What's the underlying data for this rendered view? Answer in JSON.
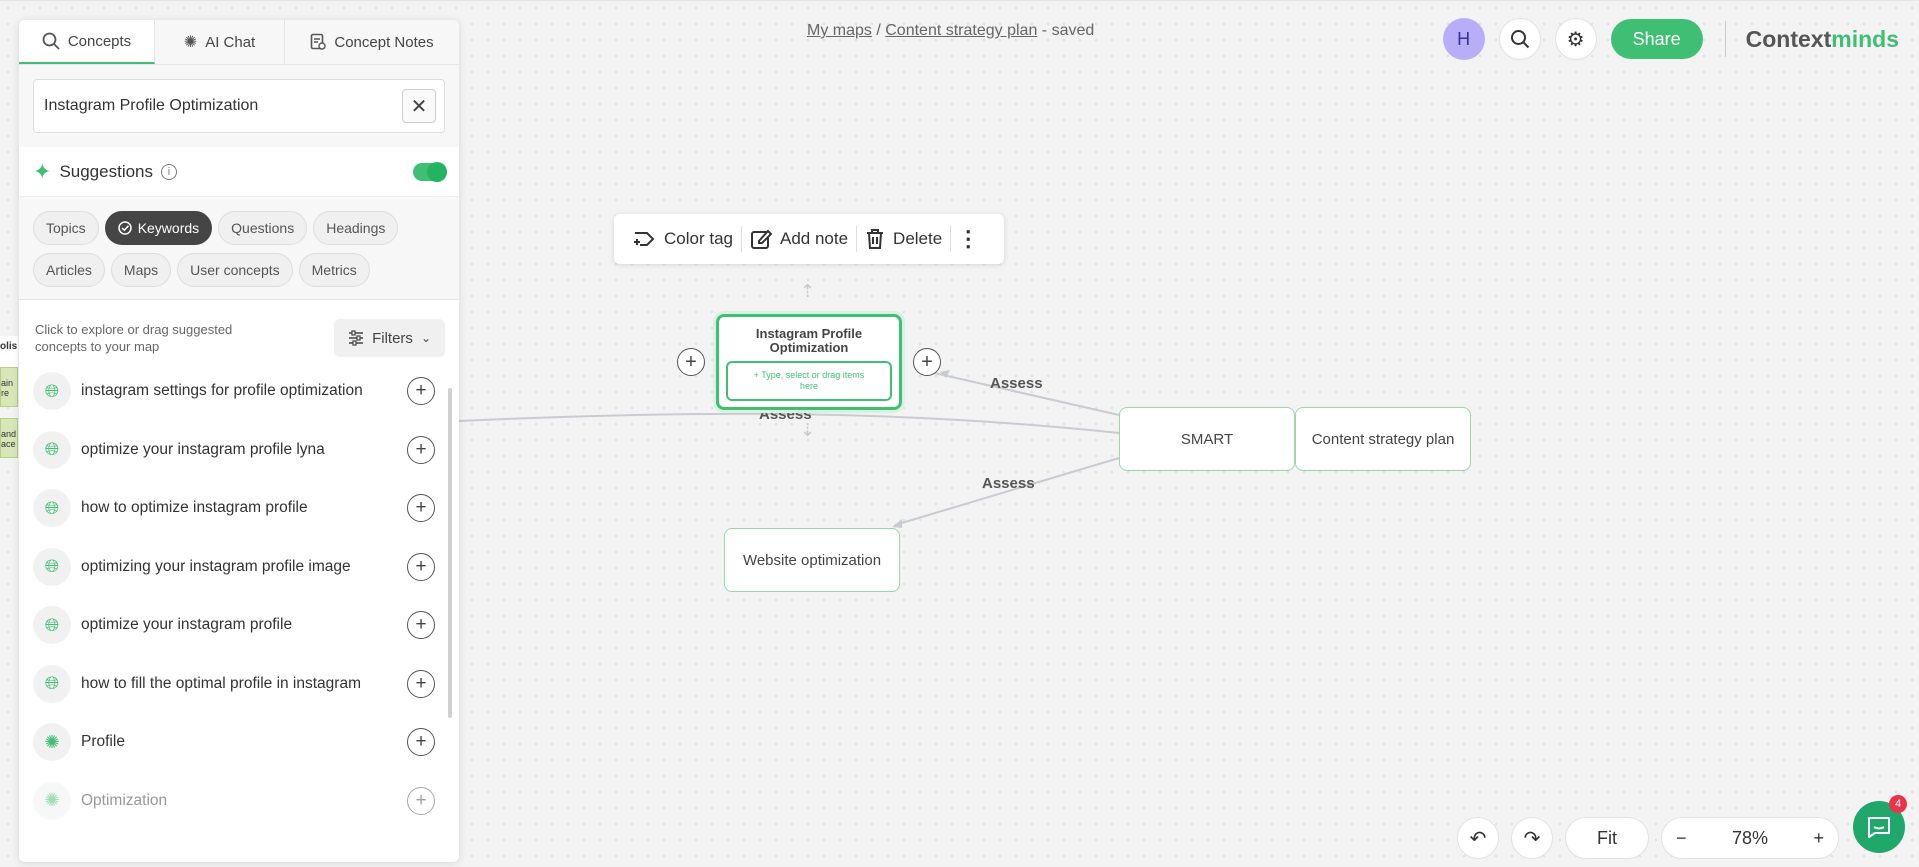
{
  "header": {
    "breadcrumb_maps": "My maps",
    "breadcrumb_sep": " / ",
    "breadcrumb_map": "Content strategy plan",
    "breadcrumb_status": " - saved",
    "avatar_initial": "H",
    "share_label": "Share",
    "brand_prefix": "Context",
    "brand_suffix": "minds",
    "brand_color": "#3fbf74"
  },
  "panel": {
    "tabs": [
      {
        "label": "Concepts",
        "icon": "search-icon"
      },
      {
        "label": "AI Chat",
        "icon": "openai-icon"
      },
      {
        "label": "Concept Notes",
        "icon": "notes-icon"
      }
    ],
    "search_value": "Instagram Profile Optimization",
    "suggestions_title": "Suggestions",
    "suggestions_enabled": true,
    "chips": [
      "Topics",
      "Keywords",
      "Questions",
      "Headings",
      "Articles",
      "Maps",
      "User concepts",
      "Metrics"
    ],
    "active_chip": "Keywords",
    "hint": "Click to explore or drag suggested concepts to your map",
    "filters_label": "Filters",
    "items": [
      {
        "label": "instagram settings for profile optimization",
        "icon": "globe-icon"
      },
      {
        "label": "optimize your instagram profile lyna",
        "icon": "globe-icon"
      },
      {
        "label": "how to optimize instagram profile",
        "icon": "globe-icon"
      },
      {
        "label": "optimizing your instagram profile image",
        "icon": "globe-icon"
      },
      {
        "label": "optimize your instagram profile",
        "icon": "globe-icon"
      },
      {
        "label": "how to fill the optimal profile in instagram",
        "icon": "globe-icon"
      },
      {
        "label": "Profile",
        "icon": "openai-icon"
      },
      {
        "label": "Optimization",
        "icon": "openai-icon"
      }
    ]
  },
  "toolbar": {
    "color_tag": "Color tag",
    "add_note": "Add note",
    "delete": "Delete"
  },
  "map": {
    "selected_node_title": "Instagram Profile Optimization",
    "selected_node_input_placeholder": "+ Type, select or drag items here",
    "smart_node": "SMART",
    "root_node": "Content strategy plan",
    "website_node": "Website optimization",
    "edge_label": "Assess",
    "left_partial_labels": [
      "olis",
      "ain re",
      "and ace"
    ]
  },
  "bottom": {
    "fit_label": "Fit",
    "zoom_level": "78%",
    "chat_badge": "4"
  }
}
